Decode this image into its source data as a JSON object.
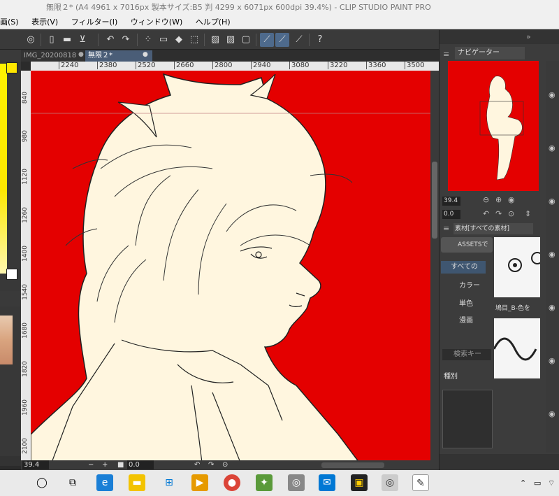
{
  "window": {
    "title": "無限２* (A4 4961 x 7016px 製本サイズ:B5 判 4299 x 6071px 600dpi 39.4%) - CLIP STUDIO PAINT PRO"
  },
  "menu": {
    "items": [
      "画(S)",
      "表示(V)",
      "フィルター(I)",
      "ウィンドウ(W)",
      "ヘルプ(H)"
    ]
  },
  "tabs": [
    {
      "label": "IMG_20200818"
    },
    {
      "label": "無限２*"
    }
  ],
  "ruler": {
    "top_ticks": [
      "2240",
      "2380",
      "2520",
      "2660",
      "2800",
      "2940",
      "3080",
      "3220",
      "3360",
      "3500",
      "364"
    ],
    "left_ticks": [
      "840",
      "980",
      "1120",
      "1260",
      "1400",
      "1540",
      "1680",
      "1820",
      "1960",
      "2100"
    ]
  },
  "status": {
    "zoom": "39.4",
    "rotation": "0.0"
  },
  "navigator": {
    "tab_label": "ナビゲーター",
    "zoom": "39.4",
    "rotation": "0.0"
  },
  "materials": {
    "tab_label": "素材[すべての素材]",
    "assets_label": "ASSETSで",
    "tree": [
      "すべての",
      "カラー",
      "単色",
      "漫画"
    ],
    "search_placeholder": "検索キー",
    "kind_label": "種別",
    "thumb_caption": "鳩目_B-色を"
  },
  "colors": {
    "canvas_bg": "#e40000",
    "skin": "#fff6df",
    "accent": "#4e6a8c"
  }
}
